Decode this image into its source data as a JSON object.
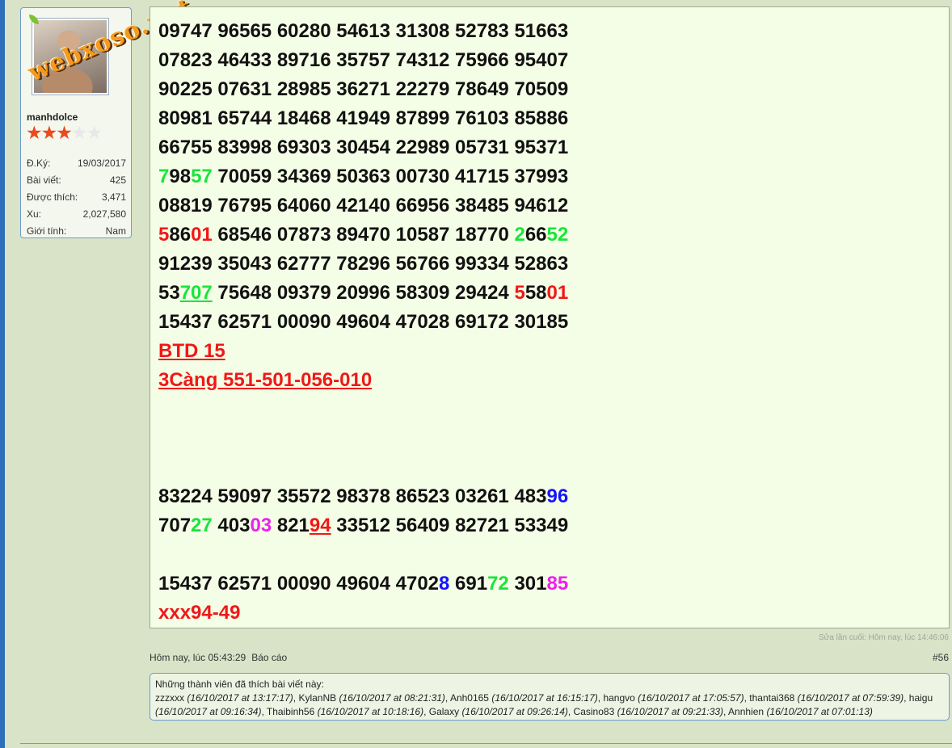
{
  "user": {
    "watermark": "webxoso.net",
    "username": "manhdolce",
    "rating_stars": 3,
    "rating_max": 5,
    "stats": [
      {
        "label": "Đ.Ký:",
        "value": "19/03/2017"
      },
      {
        "label": "Bài viết:",
        "value": "425"
      },
      {
        "label": "Được thích:",
        "value": "3,471"
      },
      {
        "label": "Xu:",
        "value": "2,027,580"
      },
      {
        "label": "Giới tính:",
        "value": "Nam"
      }
    ]
  },
  "post": {
    "lines": [
      "09747 96565 60280 54613 31308 52783 51663",
      "07823 46433 89716 35757 74312 75966 95407",
      "90225 07631 28985 36271 22279 78649 70509",
      "80981 65744 18468 41949 87899 76103 85886",
      "66755 83998 69303 30454 22989 05731 95371",
      "79857 70059 34369 50363 00730 41715 37993",
      "08819 76795 64060 42140 66956 38485 94612",
      "58601 68546 07873 89470 10587 18770 26652",
      "91239 35043 62777 78296 56766 99334 52863",
      "53707 75648 09379 20996 58309 29424 55801",
      "15437 62571 00090 49604 47028 69172 30185",
      "BTD 15",
      "3Càng 551-501-056-010",
      "83224 59097 35572 98378 86523 03261 48396",
      "70727 40303 82194 33512 56409 82721 53349",
      "15437 62571 00090 49604 47028 69172 30185",
      "xxx94-49"
    ],
    "colors": {
      "green": "#19e53a",
      "red": "#f01818",
      "blue": "#1414ff",
      "magenta": "#f01ef0"
    }
  },
  "footer": {
    "edit_note": "Sửa lần cuối: Hôm nay, lúc 14:46:06",
    "post_time": "Hôm nay, lúc 05:43:29",
    "report": "Báo cáo",
    "post_number": "#56"
  },
  "likes": {
    "title": "Những thành viên đã thích bài viết này:",
    "entries": [
      {
        "name": "zzzxxx",
        "time": "(16/10/2017 at 13:17:17)"
      },
      {
        "name": "KylanNB",
        "time": "(16/10/2017 at 08:21:31)"
      },
      {
        "name": "Anh0165",
        "time": "(16/10/2017 at 16:15:17)"
      },
      {
        "name": "hangvo",
        "time": "(16/10/2017 at 17:05:57)"
      },
      {
        "name": "thantai368",
        "time": "(16/10/2017 at 07:59:39)"
      },
      {
        "name": "haigu",
        "time": "(16/10/2017 at 09:16:34)"
      },
      {
        "name": "Thaibinh56",
        "time": "(16/10/2017 at 10:18:16)"
      },
      {
        "name": "Galaxy",
        "time": "(16/10/2017 at 09:26:14)"
      },
      {
        "name": "Casino83",
        "time": "(16/10/2017 at 09:21:33)"
      },
      {
        "name": "Annhien",
        "time": "(16/10/2017 at 07:01:13)"
      }
    ]
  }
}
